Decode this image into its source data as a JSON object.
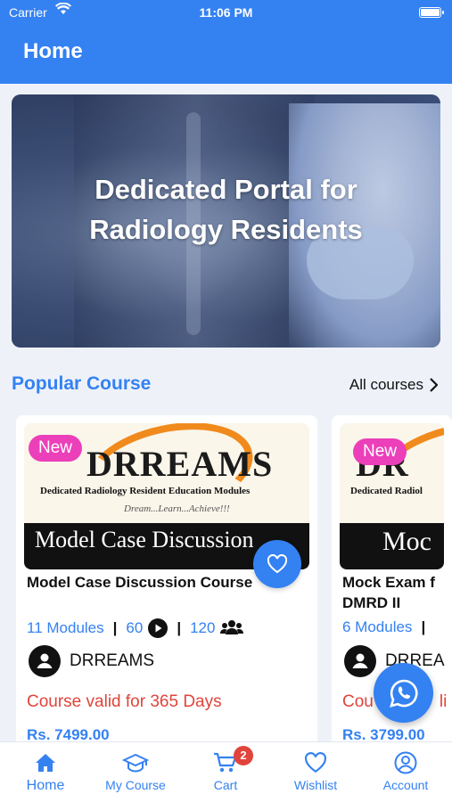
{
  "status_bar": {
    "carrier": "Carrier",
    "time": "11:06 PM"
  },
  "header": {
    "title": "Home"
  },
  "hero": {
    "caption_line1": "Dedicated Portal for",
    "caption_line2": "Radiology Residents"
  },
  "popular": {
    "section_title": "Popular Course",
    "all_courses_label": "All courses"
  },
  "courses": [
    {
      "badge": "New",
      "thumb_brand": "DRREAMS",
      "thumb_subtitle": "Dedicated Radiology Resident Education Modules",
      "thumb_tagline": "Dream...Learn...Achieve!!!",
      "thumb_name": "Model Case Discussion",
      "title": "Model Case Discussion Course",
      "modules": "11 Modules",
      "videos": "60",
      "students": "120",
      "author": "DRREAMS",
      "validity": "Course valid for 365 Days",
      "price": "Rs. 7499.00"
    },
    {
      "badge": "New",
      "thumb_brand": "DR",
      "thumb_subtitle": "Dedicated Radiol",
      "thumb_name": "Moc",
      "title_line1": "Mock Exam f",
      "title_line2": "DMRD II",
      "modules": "6 Modules",
      "author": "DRREA",
      "validity": "Cou",
      "validity_tail": "li",
      "price": "Rs. 3799.00"
    }
  ],
  "tabs": [
    {
      "label": "Home",
      "icon": "home-icon"
    },
    {
      "label": "My Course",
      "icon": "graduation-cap-icon"
    },
    {
      "label": "Cart",
      "icon": "cart-icon",
      "badge": "2"
    },
    {
      "label": "Wishlist",
      "icon": "heart-icon"
    },
    {
      "label": "Account",
      "icon": "account-icon"
    }
  ],
  "colors": {
    "primary": "#3481f2",
    "accent_pink": "#ec3fba",
    "alert_red": "#e0443b"
  }
}
